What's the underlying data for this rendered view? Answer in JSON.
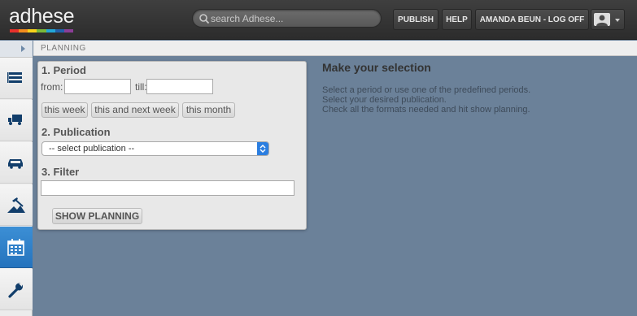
{
  "app": {
    "logo": "adhese",
    "logo_colors": [
      "#e7312c",
      "#f28c1e",
      "#f8d21b",
      "#7ab93a",
      "#23a7d8",
      "#2260ab",
      "#8b3e97"
    ]
  },
  "header": {
    "search_placeholder": "search Adhese...",
    "publish": "PUBLISH",
    "help": "HELP",
    "user": "AMANDA BEUN - LOG OFF"
  },
  "sidebar": {
    "items": [
      {
        "icon": "list-icon"
      },
      {
        "icon": "truck-icon"
      },
      {
        "icon": "car-icon"
      },
      {
        "icon": "tools-icon"
      },
      {
        "icon": "calendar-icon",
        "active": true
      },
      {
        "icon": "wrench-icon"
      }
    ]
  },
  "breadcrumb": "PLANNING",
  "panel": {
    "period_heading": "1. Period",
    "from_label": "from:",
    "till_label": "till:",
    "from_value": "",
    "till_value": "",
    "presets": [
      "this week",
      "this and next week",
      "this month"
    ],
    "publication_heading": "2. Publication",
    "publication_selected": "-- select publication --",
    "filter_heading": "3. Filter",
    "filter_value": "",
    "show_button": "SHOW PLANNING"
  },
  "info": {
    "title": "Make your selection",
    "lines": [
      "Select a period or use one of the predefined periods.",
      "Select your desired publication.",
      "Check all the formats needed and hit show planning."
    ]
  }
}
